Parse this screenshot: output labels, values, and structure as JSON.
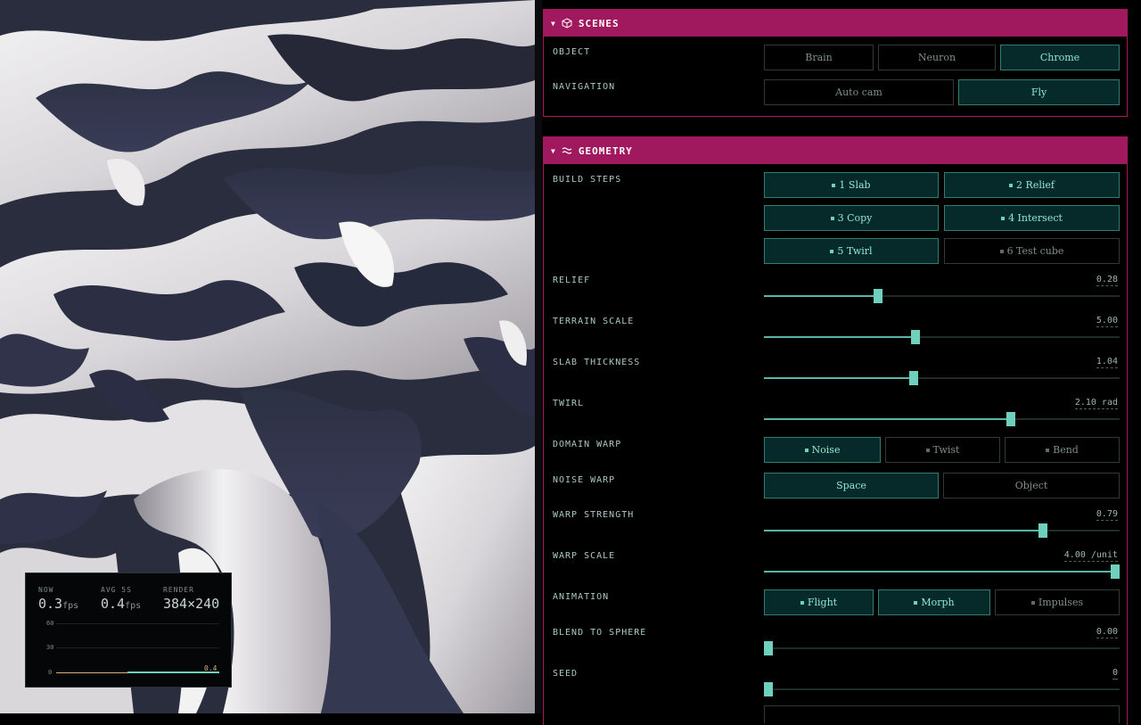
{
  "stats": {
    "now_label": "NOW",
    "now_value": "0.3",
    "avg_label": "AVG 5S",
    "avg_value": "0.4",
    "fps_unit": "fps",
    "render_label": "RENDER",
    "render_value": "384×240",
    "grid": [
      "60",
      "30",
      "0"
    ],
    "current": "0.4"
  },
  "scenes": {
    "title": "SCENES",
    "object_label": "OBJECT",
    "objects": [
      {
        "label": "Brain",
        "active": false
      },
      {
        "label": "Neuron",
        "active": false
      },
      {
        "label": "Chrome",
        "active": true
      }
    ],
    "navigation_label": "NAVIGATION",
    "navigation": [
      {
        "label": "Auto cam",
        "active": false
      },
      {
        "label": "Fly",
        "active": true
      }
    ]
  },
  "geometry": {
    "title": "GEOMETRY",
    "build_label": "BUILD STEPS",
    "build_steps": [
      {
        "label": "1 Slab",
        "active": true
      },
      {
        "label": "2 Relief",
        "active": true
      },
      {
        "label": "3 Copy",
        "active": true
      },
      {
        "label": "4 Intersect",
        "active": true
      },
      {
        "label": "5 Twirl",
        "active": true
      },
      {
        "label": "6 Test cube",
        "active": false
      }
    ],
    "relief": {
      "label": "RELIEF",
      "value": "0.28",
      "level": 0.32
    },
    "terrain": {
      "label": "TERRAIN SCALE",
      "value": "5.00",
      "level": 0.425
    },
    "slab": {
      "label": "SLAB THICKNESS",
      "value": "1.04",
      "level": 0.42
    },
    "twirl": {
      "label": "TWIRL",
      "value": "2.10 rad",
      "level": 0.695
    },
    "domain_warp_label": "DOMAIN WARP",
    "domain_warp": [
      {
        "label": "Noise",
        "active": true
      },
      {
        "label": "Twist",
        "active": false
      },
      {
        "label": "Bend",
        "active": false
      }
    ],
    "noise_warp_label": "NOISE WARP",
    "noise_warp": [
      {
        "label": "Space",
        "active": true
      },
      {
        "label": "Object",
        "active": false
      }
    ],
    "warp_strength": {
      "label": "WARP STRENGTH",
      "value": "0.79",
      "level": 0.785
    },
    "warp_scale": {
      "label": "WARP SCALE",
      "value": "4.00 /unit",
      "level": 1.0
    },
    "animation_label": "ANIMATION",
    "animation": [
      {
        "label": "Flight",
        "active": true
      },
      {
        "label": "Morph",
        "active": true
      },
      {
        "label": "Impulses",
        "active": false
      }
    ],
    "blend": {
      "label": "BLEND TO SPHERE",
      "value": "0.00",
      "level": 0.0
    },
    "seed": {
      "label": "SEED",
      "value": "0",
      "level": 0.0
    }
  },
  "colors": {
    "section_header": "#a0185d",
    "accent": "#6fd0bd",
    "button_active_bg": "#062a2a"
  },
  "icons": [
    "collapse-triangle-icon",
    "cube-icon",
    "wave-icon"
  ]
}
